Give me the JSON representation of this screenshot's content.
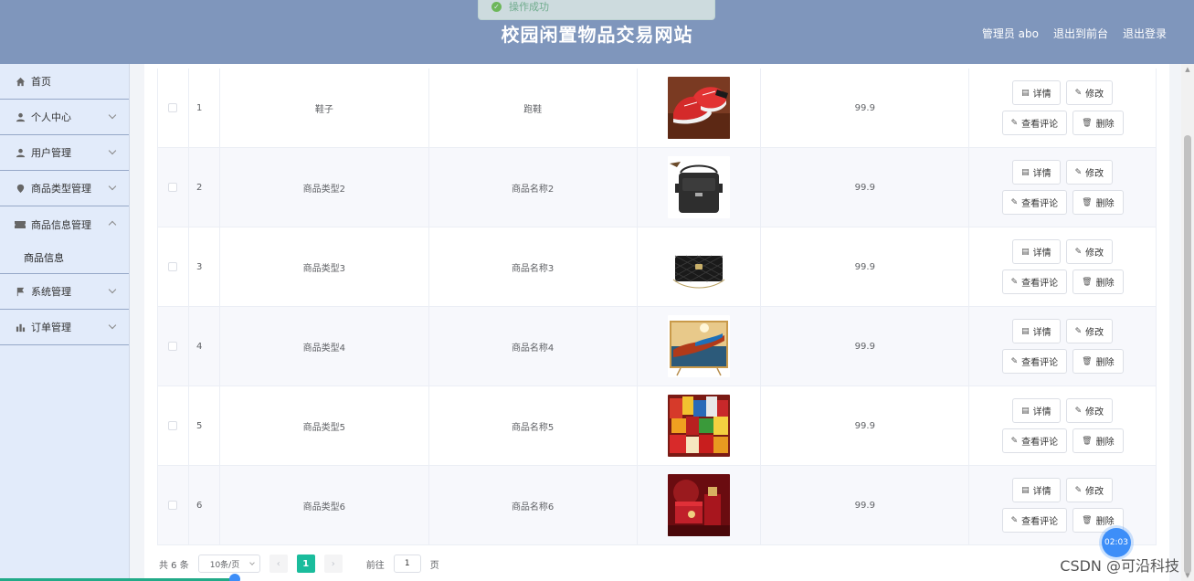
{
  "header": {
    "title": "校园闲置物品交易网站",
    "user_label": "管理员 abo",
    "front_link": "退出到前台",
    "logout_link": "退出登录"
  },
  "toast": {
    "text": "操作成功"
  },
  "sidebar": {
    "items": [
      {
        "label": "首页",
        "icon": "home-icon"
      },
      {
        "label": "个人中心",
        "icon": "user-icon"
      },
      {
        "label": "用户管理",
        "icon": "user-icon"
      },
      {
        "label": "商品类型管理",
        "icon": "location-icon"
      },
      {
        "label": "商品信息管理",
        "icon": "ticket-icon"
      },
      {
        "label": "商品信息",
        "icon": ""
      },
      {
        "label": "系统管理",
        "icon": "flag-icon"
      },
      {
        "label": "订单管理",
        "icon": "bar-chart-icon"
      }
    ]
  },
  "table": {
    "rows": [
      {
        "index": "1",
        "type": "鞋子",
        "name": "跑鞋",
        "price": "99.9",
        "image": "red-sneakers"
      },
      {
        "index": "2",
        "type": "商品类型2",
        "name": "商品名称2",
        "price": "99.9",
        "image": "black-shoulder-bag"
      },
      {
        "index": "3",
        "type": "商品类型3",
        "name": "商品名称3",
        "price": "99.9",
        "image": "quilted-purse"
      },
      {
        "index": "4",
        "type": "商品类型4",
        "name": "商品名称4",
        "price": "99.9",
        "image": "kayak-tv"
      },
      {
        "index": "5",
        "type": "商品类型5",
        "name": "商品名称5",
        "price": "99.9",
        "image": "snack-pile"
      },
      {
        "index": "6",
        "type": "商品类型6",
        "name": "商品名称6",
        "price": "99.9",
        "image": "red-gift-box"
      }
    ],
    "actions": {
      "detail": "详情",
      "edit": "修改",
      "comments": "查看评论",
      "delete": "删除"
    }
  },
  "pagination": {
    "total_text": "共 6 条",
    "page_size": "10条/页",
    "current_page": "1",
    "goto_label": "前往",
    "goto_value": "1",
    "page_suffix": "页"
  },
  "overlay": {
    "timer": "02:03",
    "watermark": "CSDN @可沿科技"
  },
  "colors": {
    "header_bg": "#7f96bc",
    "sidebar_bg": "#e2ebfa",
    "page_active": "#1abc9c"
  }
}
